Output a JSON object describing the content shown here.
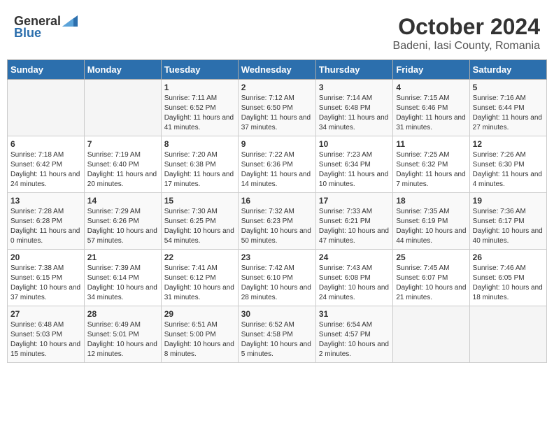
{
  "header": {
    "logo_general": "General",
    "logo_blue": "Blue",
    "month_year": "October 2024",
    "location": "Badeni, Iasi County, Romania"
  },
  "days_of_week": [
    "Sunday",
    "Monday",
    "Tuesday",
    "Wednesday",
    "Thursday",
    "Friday",
    "Saturday"
  ],
  "weeks": [
    [
      {
        "day": "",
        "sunrise": "",
        "sunset": "",
        "daylight": ""
      },
      {
        "day": "",
        "sunrise": "",
        "sunset": "",
        "daylight": ""
      },
      {
        "day": "1",
        "sunrise": "Sunrise: 7:11 AM",
        "sunset": "Sunset: 6:52 PM",
        "daylight": "Daylight: 11 hours and 41 minutes."
      },
      {
        "day": "2",
        "sunrise": "Sunrise: 7:12 AM",
        "sunset": "Sunset: 6:50 PM",
        "daylight": "Daylight: 11 hours and 37 minutes."
      },
      {
        "day": "3",
        "sunrise": "Sunrise: 7:14 AM",
        "sunset": "Sunset: 6:48 PM",
        "daylight": "Daylight: 11 hours and 34 minutes."
      },
      {
        "day": "4",
        "sunrise": "Sunrise: 7:15 AM",
        "sunset": "Sunset: 6:46 PM",
        "daylight": "Daylight: 11 hours and 31 minutes."
      },
      {
        "day": "5",
        "sunrise": "Sunrise: 7:16 AM",
        "sunset": "Sunset: 6:44 PM",
        "daylight": "Daylight: 11 hours and 27 minutes."
      }
    ],
    [
      {
        "day": "6",
        "sunrise": "Sunrise: 7:18 AM",
        "sunset": "Sunset: 6:42 PM",
        "daylight": "Daylight: 11 hours and 24 minutes."
      },
      {
        "day": "7",
        "sunrise": "Sunrise: 7:19 AM",
        "sunset": "Sunset: 6:40 PM",
        "daylight": "Daylight: 11 hours and 20 minutes."
      },
      {
        "day": "8",
        "sunrise": "Sunrise: 7:20 AM",
        "sunset": "Sunset: 6:38 PM",
        "daylight": "Daylight: 11 hours and 17 minutes."
      },
      {
        "day": "9",
        "sunrise": "Sunrise: 7:22 AM",
        "sunset": "Sunset: 6:36 PM",
        "daylight": "Daylight: 11 hours and 14 minutes."
      },
      {
        "day": "10",
        "sunrise": "Sunrise: 7:23 AM",
        "sunset": "Sunset: 6:34 PM",
        "daylight": "Daylight: 11 hours and 10 minutes."
      },
      {
        "day": "11",
        "sunrise": "Sunrise: 7:25 AM",
        "sunset": "Sunset: 6:32 PM",
        "daylight": "Daylight: 11 hours and 7 minutes."
      },
      {
        "day": "12",
        "sunrise": "Sunrise: 7:26 AM",
        "sunset": "Sunset: 6:30 PM",
        "daylight": "Daylight: 11 hours and 4 minutes."
      }
    ],
    [
      {
        "day": "13",
        "sunrise": "Sunrise: 7:28 AM",
        "sunset": "Sunset: 6:28 PM",
        "daylight": "Daylight: 11 hours and 0 minutes."
      },
      {
        "day": "14",
        "sunrise": "Sunrise: 7:29 AM",
        "sunset": "Sunset: 6:26 PM",
        "daylight": "Daylight: 10 hours and 57 minutes."
      },
      {
        "day": "15",
        "sunrise": "Sunrise: 7:30 AM",
        "sunset": "Sunset: 6:25 PM",
        "daylight": "Daylight: 10 hours and 54 minutes."
      },
      {
        "day": "16",
        "sunrise": "Sunrise: 7:32 AM",
        "sunset": "Sunset: 6:23 PM",
        "daylight": "Daylight: 10 hours and 50 minutes."
      },
      {
        "day": "17",
        "sunrise": "Sunrise: 7:33 AM",
        "sunset": "Sunset: 6:21 PM",
        "daylight": "Daylight: 10 hours and 47 minutes."
      },
      {
        "day": "18",
        "sunrise": "Sunrise: 7:35 AM",
        "sunset": "Sunset: 6:19 PM",
        "daylight": "Daylight: 10 hours and 44 minutes."
      },
      {
        "day": "19",
        "sunrise": "Sunrise: 7:36 AM",
        "sunset": "Sunset: 6:17 PM",
        "daylight": "Daylight: 10 hours and 40 minutes."
      }
    ],
    [
      {
        "day": "20",
        "sunrise": "Sunrise: 7:38 AM",
        "sunset": "Sunset: 6:15 PM",
        "daylight": "Daylight: 10 hours and 37 minutes."
      },
      {
        "day": "21",
        "sunrise": "Sunrise: 7:39 AM",
        "sunset": "Sunset: 6:14 PM",
        "daylight": "Daylight: 10 hours and 34 minutes."
      },
      {
        "day": "22",
        "sunrise": "Sunrise: 7:41 AM",
        "sunset": "Sunset: 6:12 PM",
        "daylight": "Daylight: 10 hours and 31 minutes."
      },
      {
        "day": "23",
        "sunrise": "Sunrise: 7:42 AM",
        "sunset": "Sunset: 6:10 PM",
        "daylight": "Daylight: 10 hours and 28 minutes."
      },
      {
        "day": "24",
        "sunrise": "Sunrise: 7:43 AM",
        "sunset": "Sunset: 6:08 PM",
        "daylight": "Daylight: 10 hours and 24 minutes."
      },
      {
        "day": "25",
        "sunrise": "Sunrise: 7:45 AM",
        "sunset": "Sunset: 6:07 PM",
        "daylight": "Daylight: 10 hours and 21 minutes."
      },
      {
        "day": "26",
        "sunrise": "Sunrise: 7:46 AM",
        "sunset": "Sunset: 6:05 PM",
        "daylight": "Daylight: 10 hours and 18 minutes."
      }
    ],
    [
      {
        "day": "27",
        "sunrise": "Sunrise: 6:48 AM",
        "sunset": "Sunset: 5:03 PM",
        "daylight": "Daylight: 10 hours and 15 minutes."
      },
      {
        "day": "28",
        "sunrise": "Sunrise: 6:49 AM",
        "sunset": "Sunset: 5:01 PM",
        "daylight": "Daylight: 10 hours and 12 minutes."
      },
      {
        "day": "29",
        "sunrise": "Sunrise: 6:51 AM",
        "sunset": "Sunset: 5:00 PM",
        "daylight": "Daylight: 10 hours and 8 minutes."
      },
      {
        "day": "30",
        "sunrise": "Sunrise: 6:52 AM",
        "sunset": "Sunset: 4:58 PM",
        "daylight": "Daylight: 10 hours and 5 minutes."
      },
      {
        "day": "31",
        "sunrise": "Sunrise: 6:54 AM",
        "sunset": "Sunset: 4:57 PM",
        "daylight": "Daylight: 10 hours and 2 minutes."
      },
      {
        "day": "",
        "sunrise": "",
        "sunset": "",
        "daylight": ""
      },
      {
        "day": "",
        "sunrise": "",
        "sunset": "",
        "daylight": ""
      }
    ]
  ]
}
